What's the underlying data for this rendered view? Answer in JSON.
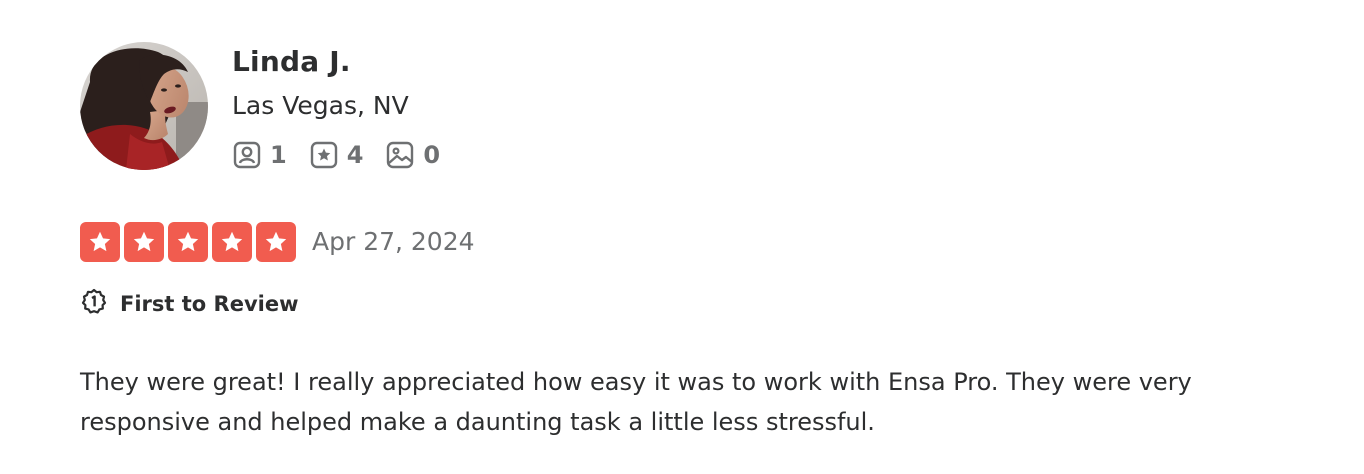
{
  "user": {
    "name": "Linda J.",
    "location": "Las Vegas, NV",
    "stats": {
      "friends": "1",
      "reviews": "4",
      "photos": "0"
    }
  },
  "review": {
    "rating": 5,
    "rating_max": 5,
    "date": "Apr 27, 2024",
    "badge": "First to Review",
    "text": "They were great! I really appreciated how easy it was to work with Ensa Pro. They were very responsive and helped make a daunting task a little less stressful."
  },
  "colors": {
    "star_fill": "#f15c4f",
    "text_primary": "#2d2e2f",
    "text_secondary": "#6e7072"
  },
  "icons": {
    "friends": "friends-icon",
    "reviews": "review-star-icon",
    "photos": "photo-icon",
    "badge": "first-to-review-icon"
  }
}
